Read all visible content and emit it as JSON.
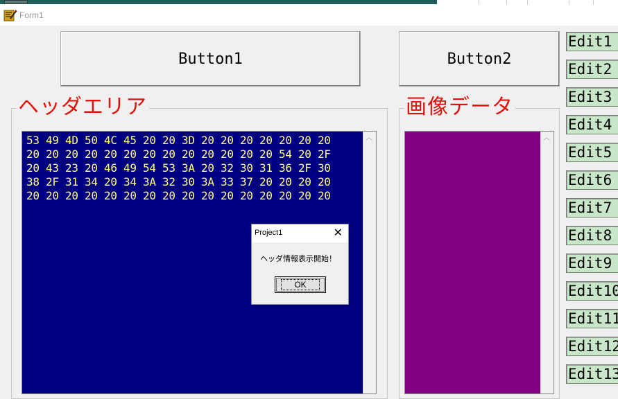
{
  "window": {
    "title": "Form1"
  },
  "buttons": {
    "button1": "Button1",
    "button2": "Button2"
  },
  "groups": {
    "header_caption": "ヘッダエリア",
    "image_caption": "画像データ"
  },
  "hex_memo": {
    "lines": [
      "53 49 4D 50 4C 45 20 20 3D 20 20 20 20 20 20 20",
      "20 20 20 20 20 20 20 20 20 20 20 20 20 54 20 2F",
      "20 43 23 20 46 49 54 53 3A 20 32 30 31 36 2F 30",
      "38 2F 31 34 20 34 3A 32 30 3A 33 37 20 20 20 20",
      "20 20 20 20 20 20 20 20 20 20 20 20 20 20 20 20"
    ]
  },
  "image_data": {
    "fill_color": "#800080"
  },
  "edits": [
    "Edit1",
    "Edit2",
    "Edit3",
    "Edit4",
    "Edit5",
    "Edit6",
    "Edit7",
    "Edit8",
    "Edit9",
    "Edit10",
    "Edit11",
    "Edit12",
    "Edit13"
  ],
  "dialog": {
    "title": "Project1",
    "message": "ヘッダ情報表示開始！",
    "ok_label": "OK",
    "close_icon": "close-icon"
  },
  "colors": {
    "memo_bg": "#000080",
    "memo_text": "#ffff80",
    "caption_red": "#e0140c",
    "edit_bg": "#c8e6c8"
  }
}
